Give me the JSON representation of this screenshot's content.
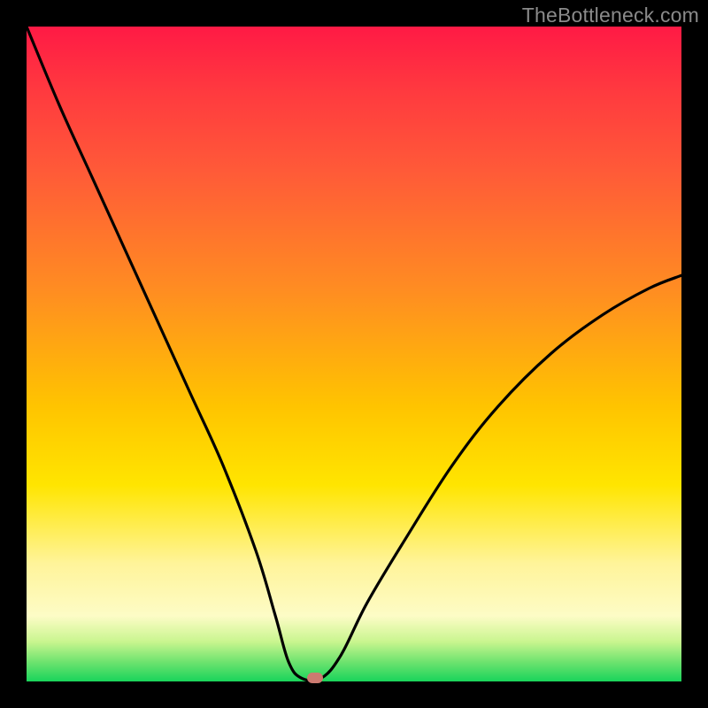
{
  "watermark": "TheBottleneck.com",
  "colors": {
    "frame_bg": "#000000",
    "gradient_top": "#ff1a45",
    "gradient_bottom": "#19d45b",
    "curve_stroke": "#000000",
    "marker_fill": "#cc7a70"
  },
  "chart_data": {
    "type": "line",
    "title": "",
    "xlabel": "",
    "ylabel": "",
    "xlim": [
      0,
      100
    ],
    "ylim": [
      0,
      100
    ],
    "annotations": [
      "TheBottleneck.com"
    ],
    "description": "V-shaped bottleneck curve on red→green vertical gradient; minimum (optimal point) near x≈43 with a short flat floor and a marker dot.",
    "series": [
      {
        "name": "bottleneck-curve",
        "x": [
          0,
          5,
          10,
          15,
          20,
          25,
          30,
          35,
          38,
          40,
          42,
          45,
          48,
          52,
          58,
          65,
          72,
          80,
          88,
          95,
          100
        ],
        "y": [
          100,
          88,
          77,
          66,
          55,
          44,
          33,
          20,
          10,
          3,
          0.5,
          0.5,
          4,
          12,
          22,
          33,
          42,
          50,
          56,
          60,
          62
        ]
      }
    ],
    "marker": {
      "x": 44,
      "y": 0.5
    }
  }
}
